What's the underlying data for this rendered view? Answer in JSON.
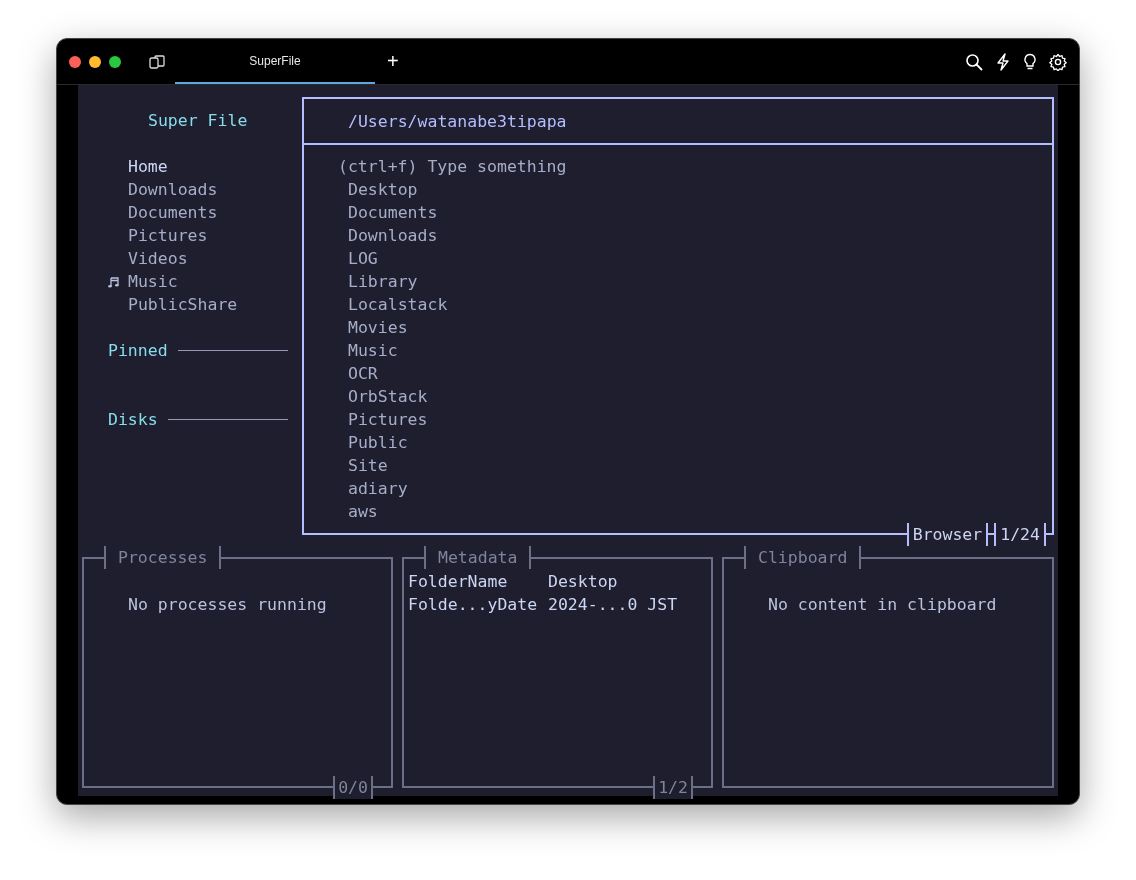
{
  "window": {
    "tab": {
      "title": "SuperFile",
      "selected": true
    },
    "new_tab": "+"
  },
  "sidebar": {
    "title": "Super File",
    "items": [
      {
        "label": "Home",
        "selected": true,
        "cursor": false
      },
      {
        "label": "Downloads",
        "selected": false,
        "cursor": false
      },
      {
        "label": "Documents",
        "selected": false,
        "cursor": false
      },
      {
        "label": "Pictures",
        "selected": false,
        "cursor": false
      },
      {
        "label": "Videos",
        "selected": false,
        "cursor": false
      },
      {
        "label": "Music",
        "selected": false,
        "cursor": true
      },
      {
        "label": "PublicShare",
        "selected": false,
        "cursor": false
      }
    ],
    "sections": [
      {
        "label": "Pinned"
      },
      {
        "label": "Disks"
      }
    ]
  },
  "browser": {
    "path": "/Users/watanabe3tipapa",
    "focused": true,
    "search": {
      "placeholder": "(ctrl+f) Type something"
    },
    "items": [
      "Desktop",
      "Documents",
      "Downloads",
      "LOG",
      "Library",
      "Localstack",
      "Movies",
      "Music",
      "OCR",
      "OrbStack",
      "Pictures",
      "Public",
      "Site",
      "adiary",
      "aws"
    ],
    "title": "Browser",
    "position": "1/24"
  },
  "processes": {
    "title": "Processes",
    "focused": false,
    "message": "No processes running",
    "position": "0/0"
  },
  "metadata": {
    "title": "Metadata",
    "focused": false,
    "rows": [
      {
        "key": "FolderName",
        "value": "Desktop"
      },
      {
        "key": "Folde...yDate",
        "value": "2024-...0 JST"
      }
    ],
    "position": "1/2"
  },
  "clipboard": {
    "title": "Clipboard",
    "focused": false,
    "message": "No content in clipboard"
  }
}
